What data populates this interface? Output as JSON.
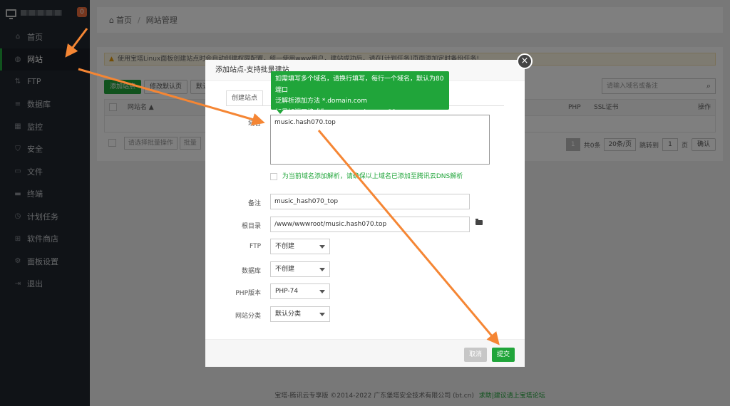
{
  "sidebar": {
    "badge": "0",
    "items": [
      {
        "label": "首页",
        "icon": "home-icon",
        "glyph": "⌂"
      },
      {
        "label": "网站",
        "icon": "globe-icon",
        "glyph": "◍"
      },
      {
        "label": "FTP",
        "icon": "ftp-icon",
        "glyph": "⇅"
      },
      {
        "label": "数据库",
        "icon": "database-icon",
        "glyph": "≡"
      },
      {
        "label": "监控",
        "icon": "monitor-icon",
        "glyph": "▦"
      },
      {
        "label": "安全",
        "icon": "shield-icon",
        "glyph": "⛉"
      },
      {
        "label": "文件",
        "icon": "folder-icon",
        "glyph": "▭"
      },
      {
        "label": "终端",
        "icon": "terminal-icon",
        "glyph": "▬"
      },
      {
        "label": "计划任务",
        "icon": "clock-icon",
        "glyph": "◷"
      },
      {
        "label": "软件商店",
        "icon": "grid-icon",
        "glyph": "⊞"
      },
      {
        "label": "面板设置",
        "icon": "gear-icon",
        "glyph": "⚙"
      },
      {
        "label": "退出",
        "icon": "logout-icon",
        "glyph": "⇥"
      }
    ]
  },
  "breadcrumb": {
    "home": "首页",
    "current": "网站管理"
  },
  "warning": "使用宝塔Linux面板创建站点时会自动创建权限配置，统一使用www用户，建站成功后，请在[计划任务]页面添加定时备份任务!",
  "toolbar": {
    "add_site": "添加站点",
    "modify_default": "修改默认页",
    "default_site": "默认"
  },
  "search": {
    "placeholder": "请输入域名或备注"
  },
  "table": {
    "col_name": "网站名 ▲",
    "col_php": "PHP",
    "col_ssl": "SSL证书",
    "col_ops": "操作"
  },
  "batch": {
    "select": "请选择批量操作",
    "batch": "批量"
  },
  "pager": {
    "page": "1",
    "total": "共0条",
    "per_page": "20条/页",
    "jump": "跳转到",
    "jump_value": "1",
    "unit": "页",
    "confirm": "确认"
  },
  "copyright": {
    "text": "宝塔-腾讯云专享版 ©2014-2022 广东堡塔安全技术有限公司 (bt.cn)",
    "link": "求助|建议请上宝塔论坛"
  },
  "modal": {
    "title": "添加站点-支持批量建站",
    "tab": "创建站点",
    "tooltip_lines": [
      "如需填写多个域名，请换行填写，每行一个域名，默认为80端口",
      "泛解析添加方法 *.domain.com",
      "如另加端口格式为 www.domain.com:88"
    ],
    "domain_label": "域名",
    "domain_value": "music.hash070.top",
    "dns_note": "为当前域名添加解析，请确保以上域名已添加至腾讯云DNS解析",
    "remark_label": "备注",
    "remark_value": "music_hash070_top",
    "root_label": "根目录",
    "root_value": "/www/wwwroot/music.hash070.top",
    "ftp_label": "FTP",
    "ftp_value": "不创建",
    "db_label": "数据库",
    "db_value": "不创建",
    "php_label": "PHP版本",
    "php_value": "PHP-74",
    "category_label": "网站分类",
    "category_value": "默认分类",
    "cancel": "取消",
    "submit": "提交"
  },
  "colors": {
    "accent": "#20a53a",
    "annotation": "#f58634",
    "sidebar": "#20262f"
  }
}
